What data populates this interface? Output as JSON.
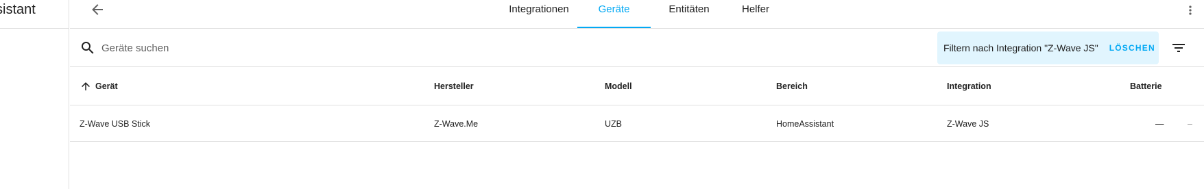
{
  "app": {
    "title": "sistant"
  },
  "tabs": [
    {
      "label": "Integrationen",
      "active": false
    },
    {
      "label": "Geräte",
      "active": true
    },
    {
      "label": "Entitäten",
      "active": false
    },
    {
      "label": "Helfer",
      "active": false
    }
  ],
  "search": {
    "placeholder": "Geräte suchen",
    "value": ""
  },
  "filter": {
    "label": "Filtern nach Integration \"Z-Wave JS\"",
    "clear_label": "LÖSCHEN"
  },
  "table": {
    "columns": [
      "Gerät",
      "Hersteller",
      "Modell",
      "Bereich",
      "Integration",
      "Batterie"
    ],
    "rows": [
      {
        "device": "Z-Wave USB Stick",
        "manufacturer": "Z-Wave.Me",
        "model": "UZB",
        "area": "HomeAssistant",
        "integration": "Z-Wave JS",
        "battery": "—",
        "extra": "–"
      }
    ]
  },
  "colors": {
    "accent": "#03a9f4",
    "chip_bg": "#e1f5fe",
    "divider": "#e0e0e0"
  },
  "icons": {
    "back": "arrow-left-icon",
    "menu": "dots-vertical-icon",
    "search": "magnify-icon",
    "filter": "filter-variant-icon",
    "sort": "arrow-up-icon"
  }
}
